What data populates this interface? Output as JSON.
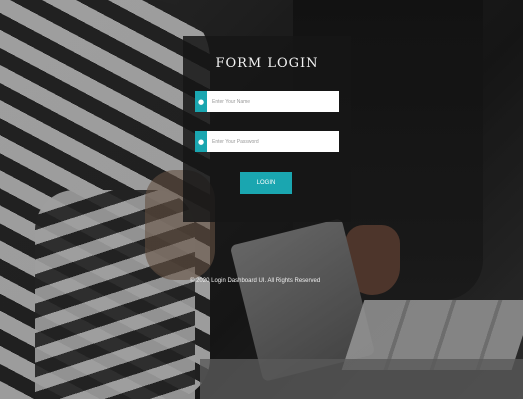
{
  "login_form": {
    "title": "FORM LOGIN",
    "username_placeholder": "Enter Your Name",
    "password_placeholder": "Enter Your Password",
    "submit_label": "LOGIN",
    "username_icon": "user-icon",
    "password_icon": "lock-icon"
  },
  "footer": {
    "copyright": "© 2020 Login Dashboard UI. All Rights Reserved"
  },
  "colors": {
    "accent": "#1aa6b0",
    "panel": "#161616"
  }
}
